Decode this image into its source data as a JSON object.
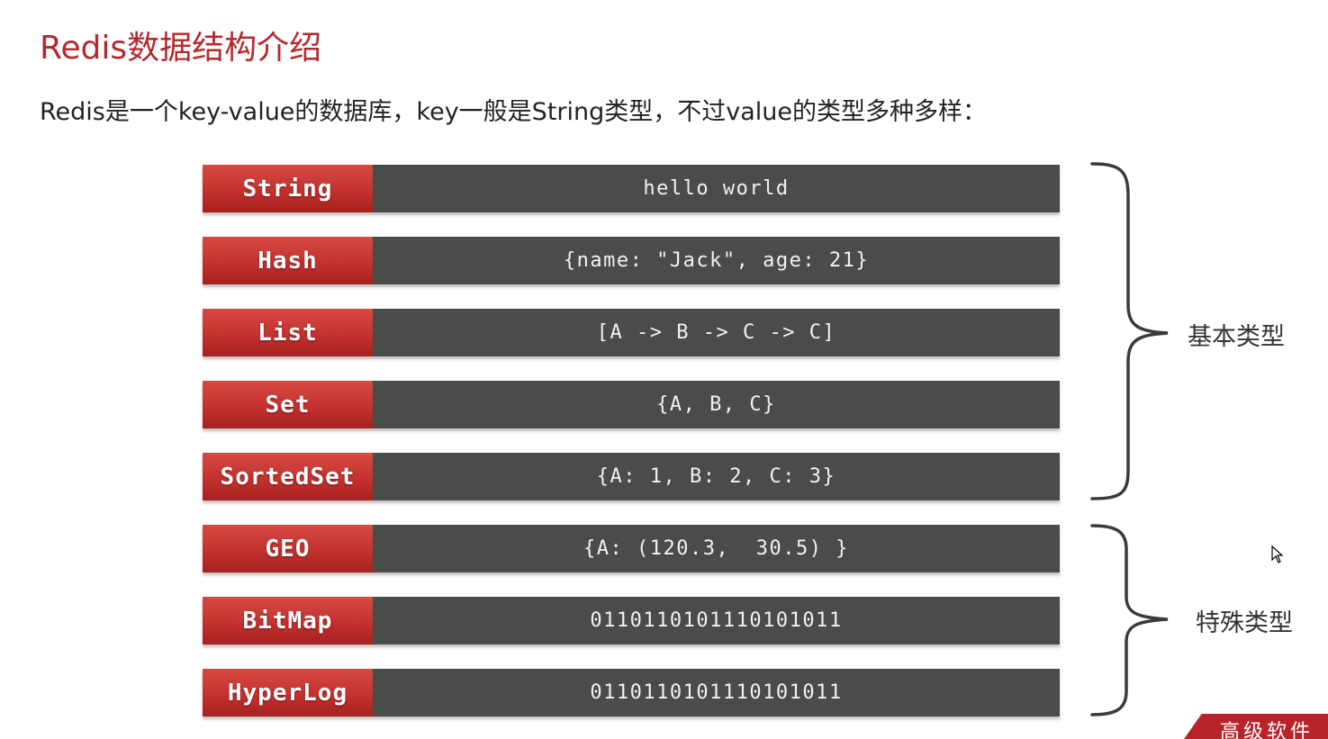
{
  "slide": {
    "title": "Redis数据结构介绍",
    "subtitle": "Redis是一个key-value的数据库，key一般是String类型，不过value的类型多种多样："
  },
  "rows": [
    {
      "name": "String",
      "value": "hello world"
    },
    {
      "name": "Hash",
      "value": "{name: \"Jack\", age: 21}"
    },
    {
      "name": "List",
      "value": "[A -> B -> C -> C]"
    },
    {
      "name": "Set",
      "value": "{A, B, C}"
    },
    {
      "name": "SortedSet",
      "value": "{A: 1, B: 2, C: 3}"
    },
    {
      "name": "GEO",
      "value": "{A: (120.3,  30.5) }"
    },
    {
      "name": "BitMap",
      "value": "0110110101110101011"
    },
    {
      "name": "HyperLog",
      "value": "0110110101110101011"
    }
  ],
  "groups": {
    "basic_label": "基本类型",
    "special_label": "特殊类型"
  },
  "watermark": {
    "text": "高级软件"
  },
  "colors": {
    "title": "#b5292e",
    "name_cell": "#c4312e",
    "value_cell": "#4a4b4b",
    "brace": "#3a3a3a",
    "watermark": "#b8242a"
  }
}
